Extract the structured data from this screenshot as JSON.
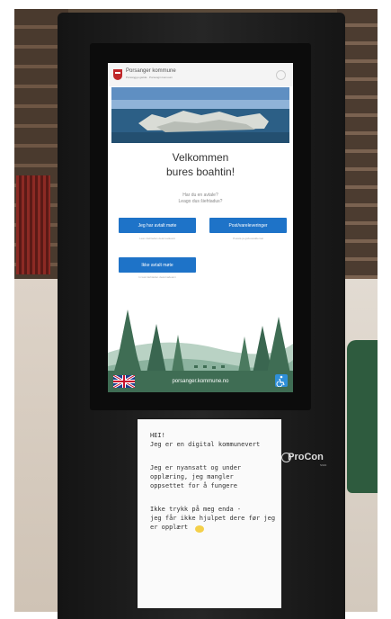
{
  "screen": {
    "municipality_name": "Porsanger kommune",
    "municipality_sub": "Porsáŋggu gielda · Porsangin komuuni",
    "welcome_line1": "Velkommen",
    "welcome_line2": "bures boahtin!",
    "question_no": "Har du en avtale?",
    "question_se": "Leago dus šiehtadus?",
    "buttons": {
      "meeting": "Jeg har avtalt møte",
      "post": "Post/vareleveringer",
      "no_meeting": "Ikke avtalt møte"
    },
    "hints": {
      "meeting": "Lean šiehtadan deaivvadeami",
      "post": "Poasta ja gálvosáddemat",
      "no_meeting": "In leat šiehtadan deaivvadeami"
    },
    "website": "porsanger.kommune.no"
  },
  "note": {
    "lines": [
      "HEI!",
      "Jeg er en digital kommunevert",
      "",
      "Jeg er nyansatt og under",
      "opplæring, jeg mangler",
      "oppsettet for å fungere",
      "",
      "Ikke trykk på meg enda -",
      "jeg får ikke hjulpet dere før jeg",
      "er opplært"
    ]
  },
  "kiosk": {
    "brand": "ProCon",
    "brand_sub": "SIGN"
  },
  "colors": {
    "button": "#1e73c8",
    "footer": "#3f6d54"
  },
  "icons": [
    "crest-icon",
    "uk-flag-icon",
    "accessibility-icon",
    "smiley-icon",
    "procon-logo-icon"
  ]
}
